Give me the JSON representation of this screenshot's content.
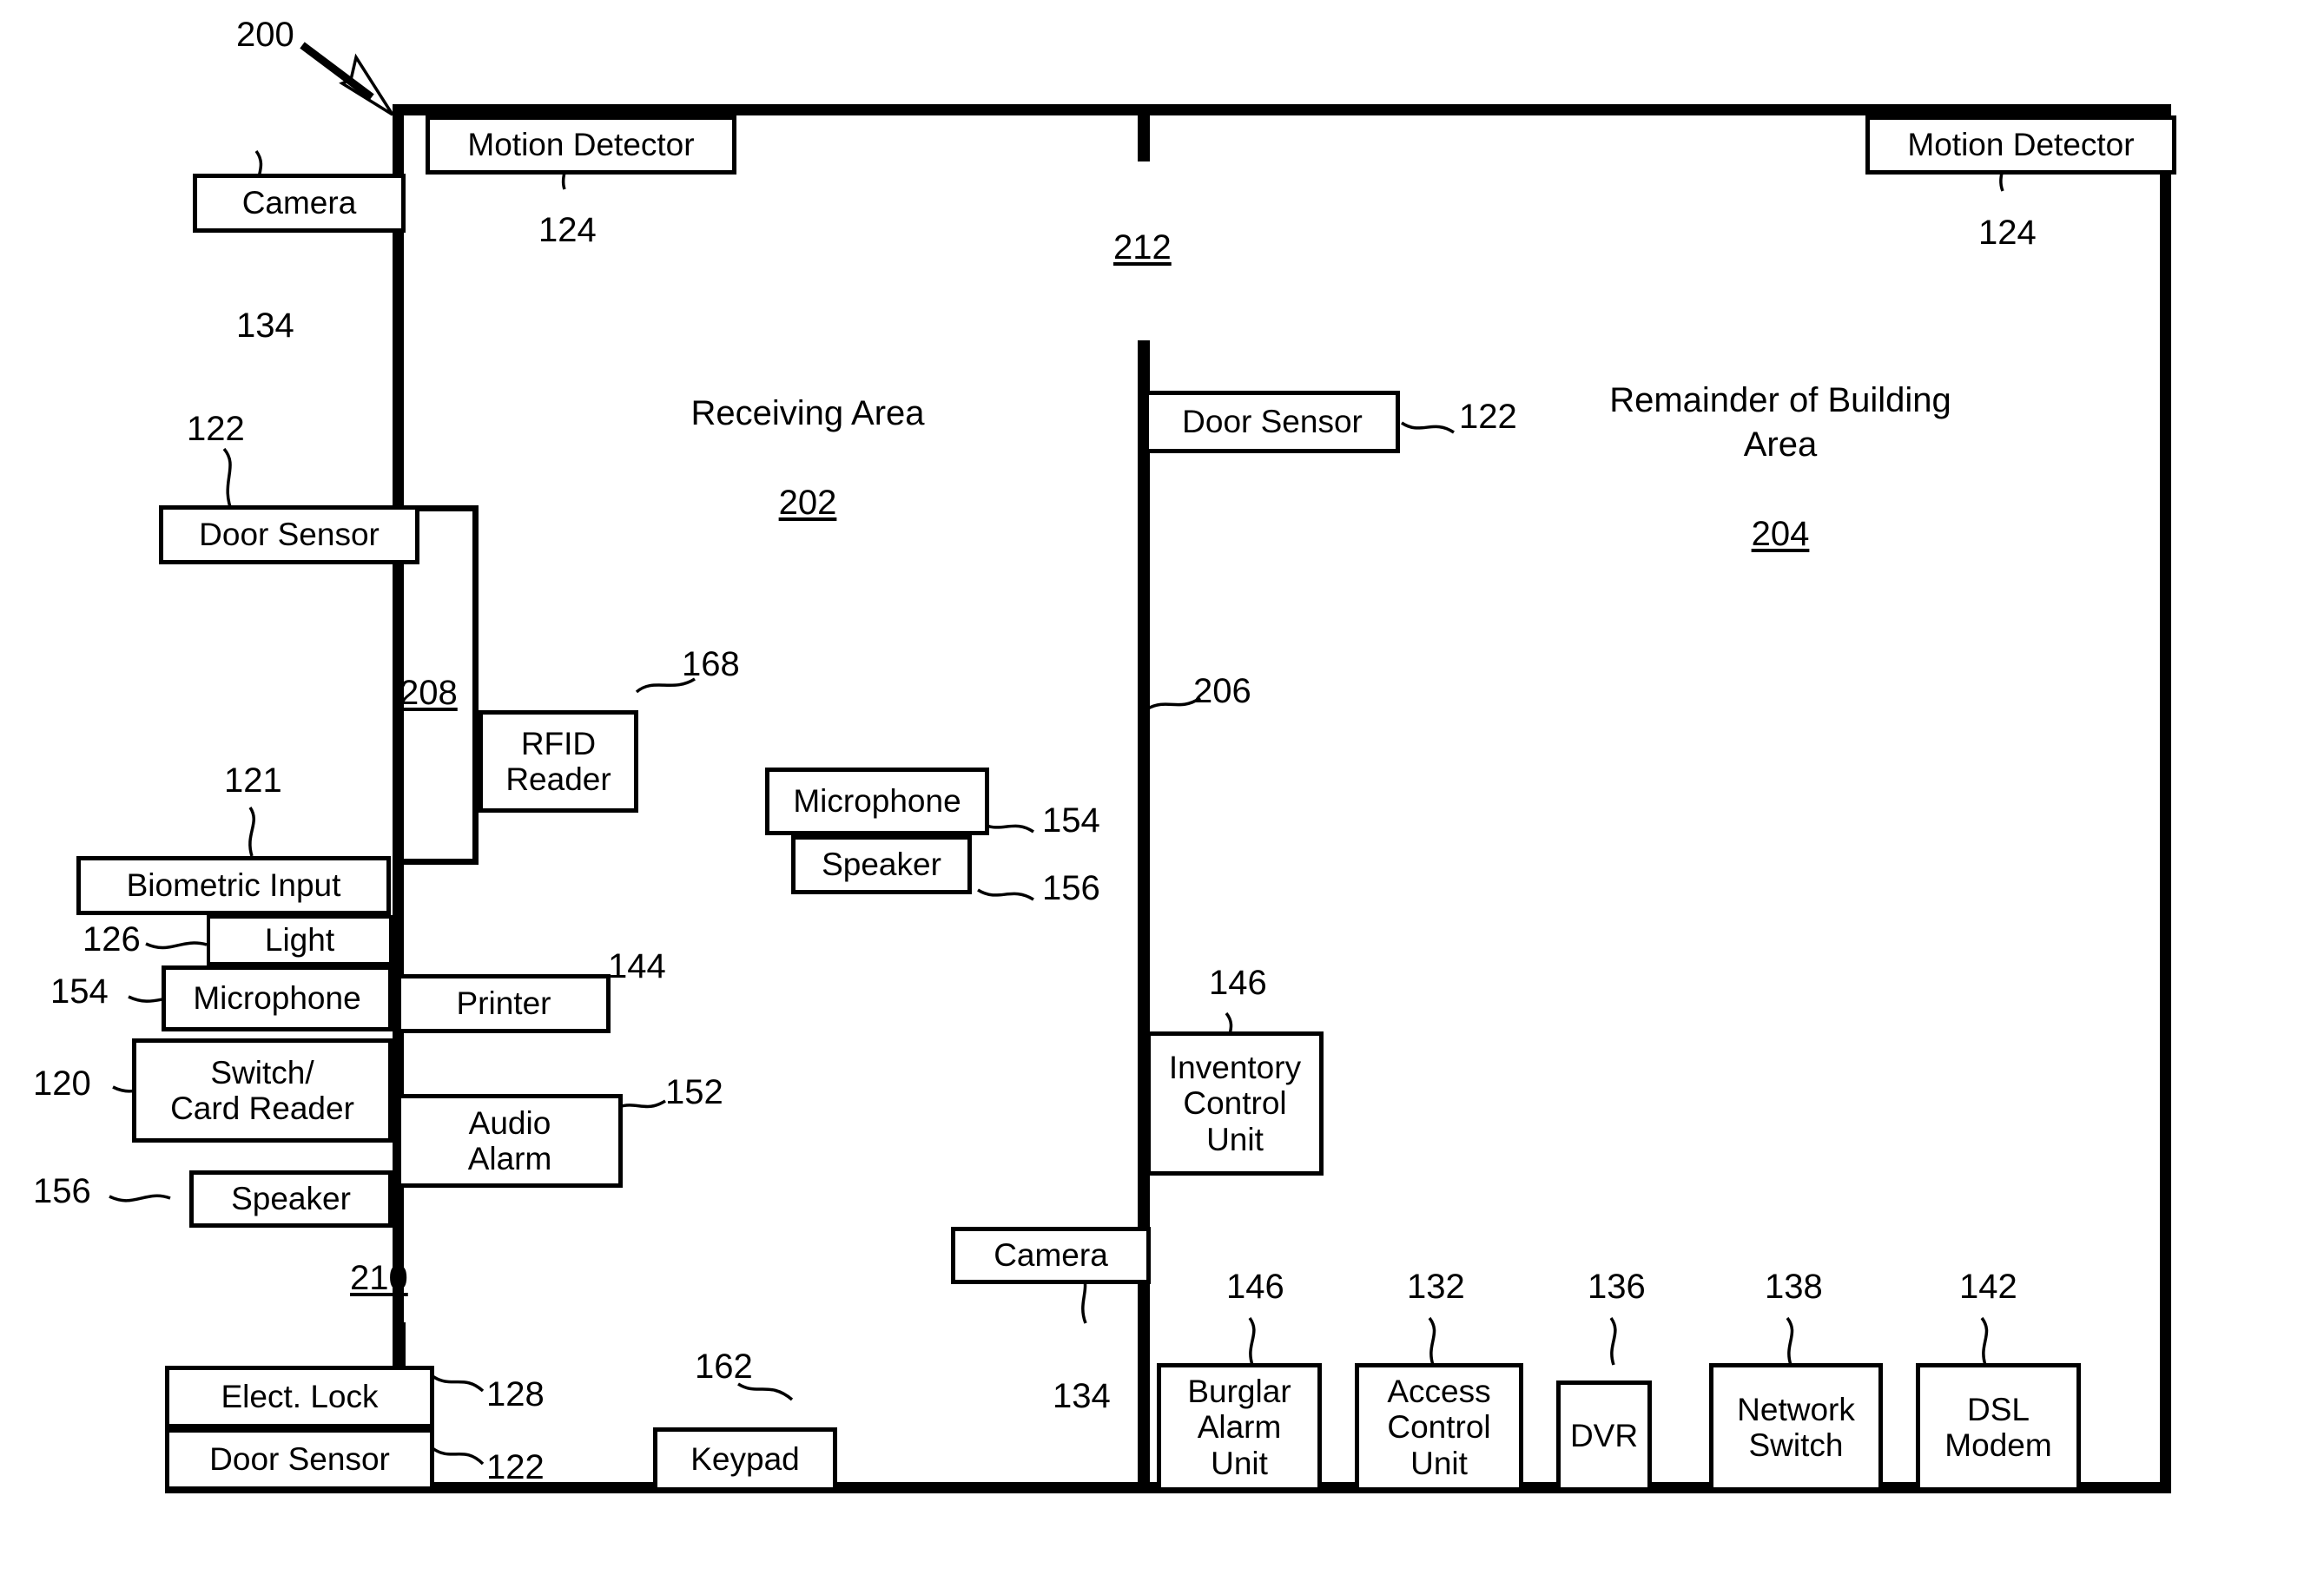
{
  "figure": {
    "number": "200",
    "areas": [
      {
        "name": "Receiving Area",
        "number": "202"
      },
      {
        "name": "Remainder of Building\nArea",
        "number": "204"
      }
    ],
    "structure_refs": [
      {
        "id": "wall-206",
        "label": "206"
      },
      {
        "id": "door-208",
        "label": "208"
      },
      {
        "id": "door-210",
        "label": "210"
      },
      {
        "id": "door-212",
        "label": "212"
      }
    ]
  },
  "components": {
    "motion_detector_left": {
      "label": "Motion Detector",
      "ref": "124"
    },
    "motion_detector_right": {
      "label": "Motion Detector",
      "ref": "124"
    },
    "camera_top_left": {
      "label": "Camera",
      "ref": "134"
    },
    "door_sensor_left": {
      "label": "Door Sensor",
      "ref": "122"
    },
    "rfid_reader": {
      "label": "RFID\nReader",
      "ref": "168"
    },
    "biometric_input": {
      "label": "Biometric Input",
      "ref": "121"
    },
    "light": {
      "label": "Light",
      "ref": "126"
    },
    "microphone_left": {
      "label": "Microphone",
      "ref": "154"
    },
    "printer": {
      "label": "Printer",
      "ref": "144"
    },
    "switch_card_reader": {
      "label": "Switch/\nCard Reader",
      "ref": "120"
    },
    "audio_alarm": {
      "label": "Audio\nAlarm",
      "ref": "152"
    },
    "speaker_left": {
      "label": "Speaker",
      "ref": "156"
    },
    "elect_lock": {
      "label": "Elect. Lock",
      "ref": "128"
    },
    "door_sensor_bottom_left": {
      "label": "Door Sensor",
      "ref": "122"
    },
    "keypad": {
      "label": "Keypad",
      "ref": "162"
    },
    "microphone_center": {
      "label": "Microphone",
      "ref": "154"
    },
    "speaker_center": {
      "label": "Speaker",
      "ref": "156"
    },
    "door_sensor_center": {
      "label": "Door Sensor",
      "ref": "122"
    },
    "inventory_control_unit": {
      "label": "Inventory\nControl\nUnit",
      "ref": "146"
    },
    "camera_bottom": {
      "label": "Camera",
      "ref": "134"
    },
    "burglar_alarm_unit": {
      "label": "Burglar\nAlarm\nUnit",
      "ref": "146"
    },
    "access_control_unit": {
      "label": "Access\nControl\nUnit",
      "ref": "132"
    },
    "dvr": {
      "label": "DVR",
      "ref": "136"
    },
    "network_switch": {
      "label": "Network\nSwitch",
      "ref": "138"
    },
    "dsl_modem": {
      "label": "DSL\nModem",
      "ref": "142"
    }
  },
  "colors": {
    "ink": "#000000",
    "paper": "#ffffff"
  }
}
